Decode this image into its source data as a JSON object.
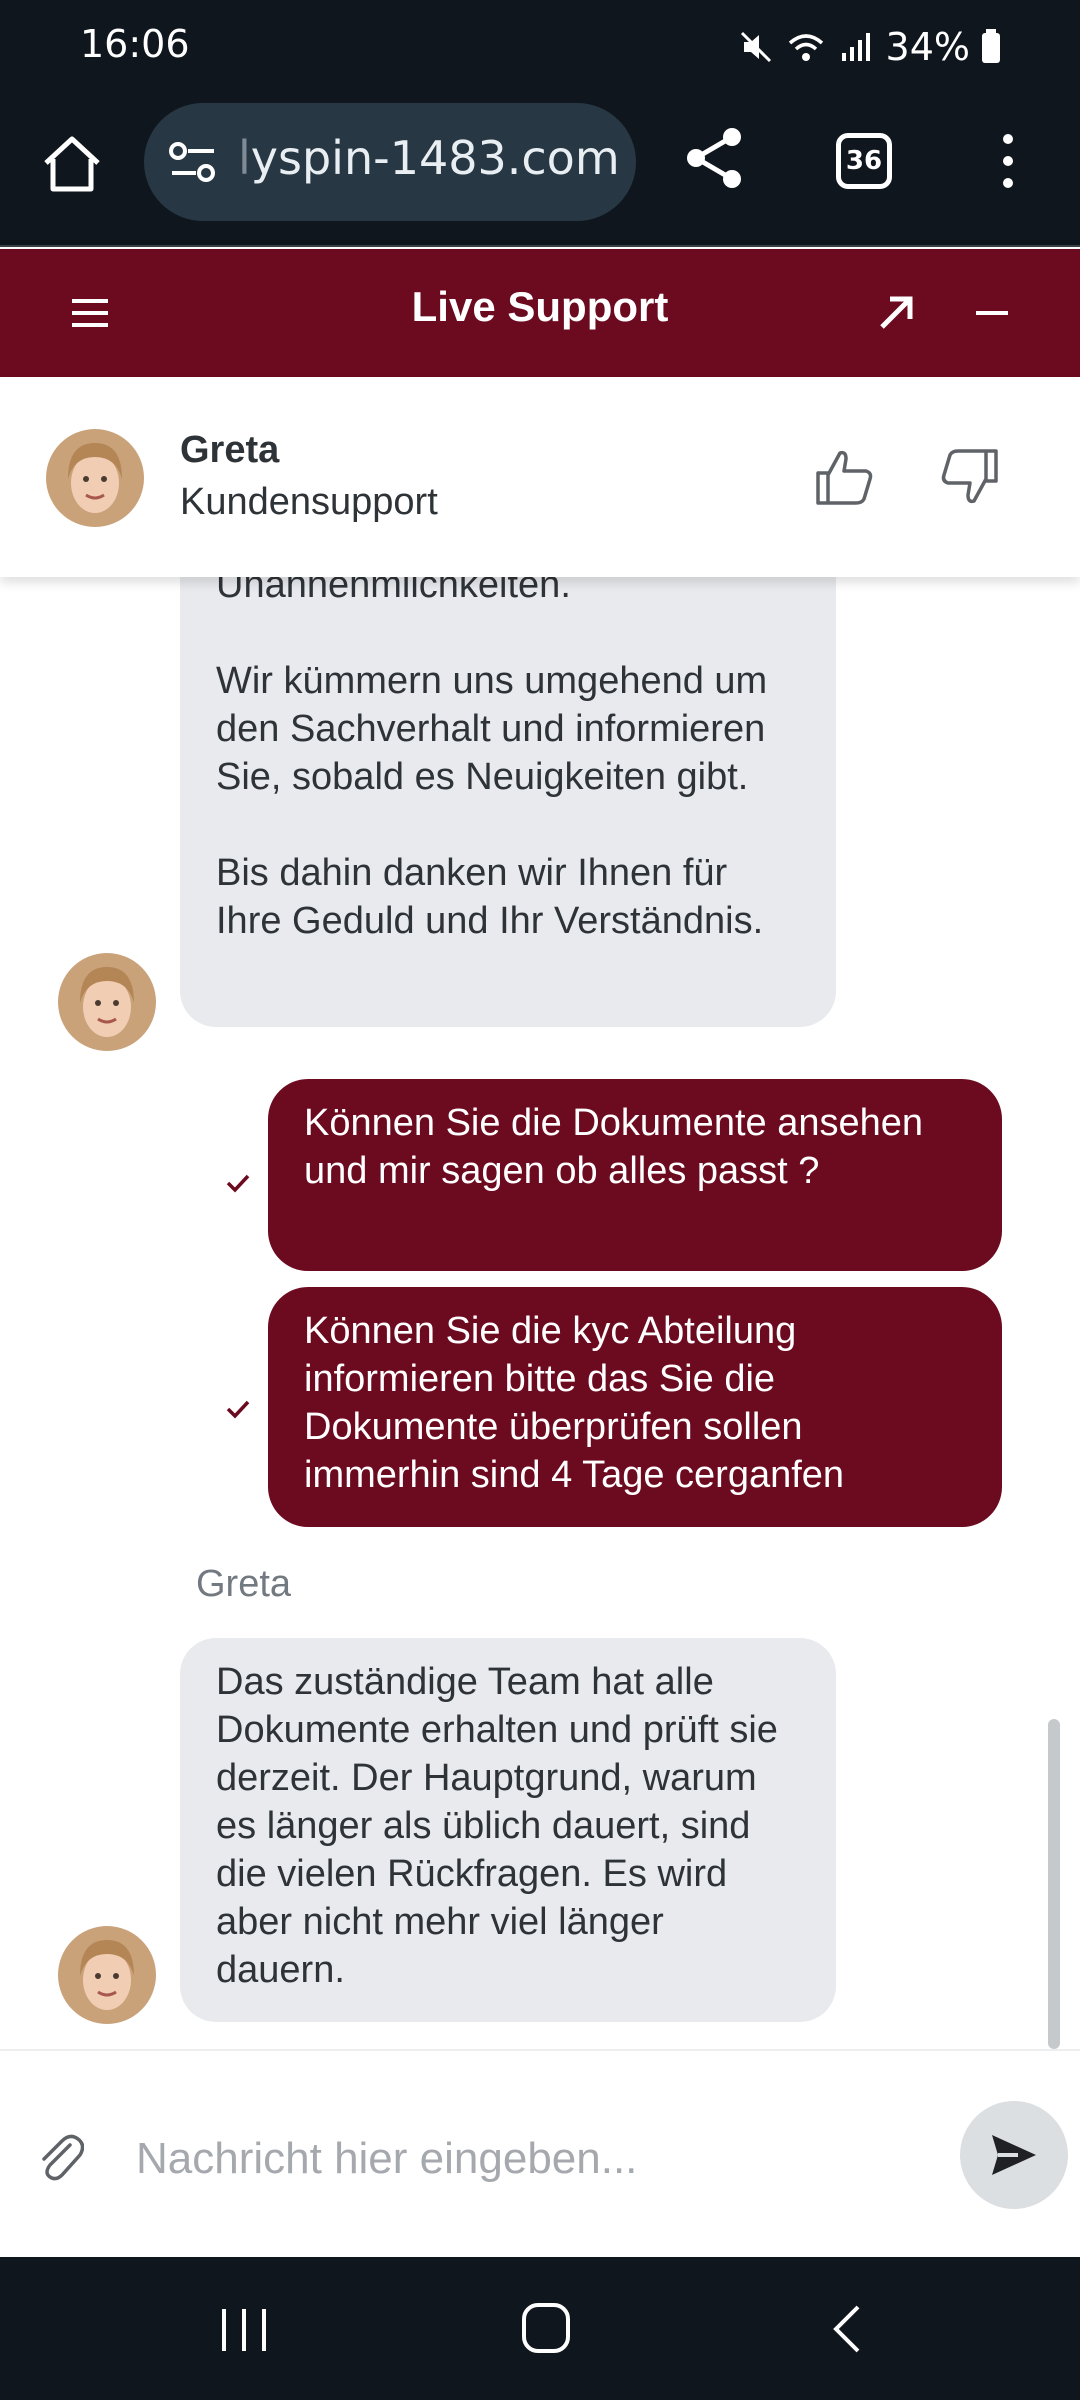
{
  "status_bar": {
    "time": "16:06",
    "battery": "34%"
  },
  "browser": {
    "url_faded": "l",
    "url": "yspin-1483.com",
    "tab_count": "36"
  },
  "chat_header": {
    "title": "Live Support"
  },
  "agent": {
    "name": "Greta",
    "role": "Kundensupport"
  },
  "messages": {
    "agent_msg_1": {
      "partial": "Unannehmlichkeiten.",
      "para_2": "Wir kümmern uns umgehend um den Sachverhalt und informieren Sie, sobald es Neuigkeiten gibt.",
      "para_3": "Bis dahin danken wir Ihnen für Ihre Geduld und Ihr Verständnis."
    },
    "user_msg_1": "Können Sie die Dokumente ansehen und mir sagen ob alles passt ?",
    "user_msg_2": "Können Sie die kyc Abteilung informieren bitte das Sie die Dokumente überprüfen sollen immerhin sind 4 Tage cerganfen",
    "sender_label": "Greta",
    "agent_msg_2": "Das zuständige Team hat alle Dokumente erhalten und prüft sie derzeit. Der Hauptgrund, warum es länger als üblich dauert, sind die vielen Rückfragen. Es wird aber nicht mehr viel länger dauern."
  },
  "input": {
    "placeholder": "Nachricht hier eingeben..."
  },
  "colors": {
    "brand": "#6c0a1f",
    "agent_bubble": "#e8eaed",
    "system_bar": "#10161d"
  }
}
